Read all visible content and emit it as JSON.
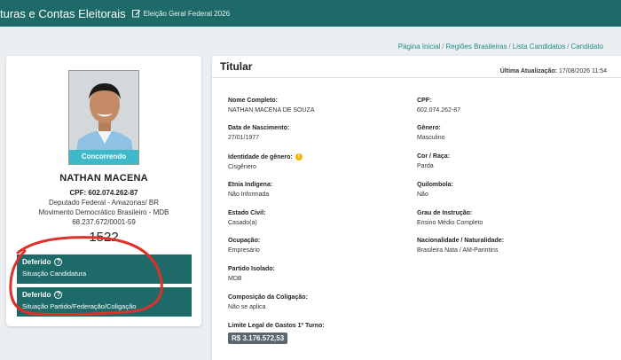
{
  "header": {
    "title": "turas e Contas Eleitorais",
    "election_label": "Eleição Geral Federal 2026"
  },
  "breadcrumb": [
    "Página Inicial",
    "Regiões Brasileiras",
    "Lista Candidatos",
    "Candidato"
  ],
  "candidate": {
    "status_tag": "Concorrendo",
    "name": "NATHAN MACENA",
    "cpf_line": "CPF: 602.074.262-87",
    "office": "Deputado Federal - Amazonas/ BR",
    "party": "Movimento Democrático Brasileiro - MDB",
    "cnpj": "68.237.672/0001-59",
    "number": "1522"
  },
  "status_boxes": [
    {
      "title": "Deferido",
      "subtitle": "Situação Candidatura"
    },
    {
      "title": "Deferido",
      "subtitle": "Situação Partido/Federação/Coligação"
    }
  ],
  "details": {
    "heading": "Titular",
    "updated_label": "Última Atualização:",
    "updated_value": "17/08/2026 11:54",
    "fields": {
      "full_name": {
        "label": "Nome Completo:",
        "value": "NATHAN MACENA DE SOUZA"
      },
      "cpf": {
        "label": "CPF:",
        "value": "602.074.262-87"
      },
      "birth": {
        "label": "Data de Nascimento:",
        "value": "27/01/1977"
      },
      "gender": {
        "label": "Gênero:",
        "value": "Masculino"
      },
      "gender_identity": {
        "label": "Identidade de gênero:",
        "value": "Cisgênero"
      },
      "race": {
        "label": "Cor / Raça:",
        "value": "Parda"
      },
      "ethnicity": {
        "label": "Etnia Indígena:",
        "value": "Não Informada"
      },
      "quilombola": {
        "label": "Quilombola:",
        "value": "Não"
      },
      "civil": {
        "label": "Estado Civil:",
        "value": "Casado(a)"
      },
      "education": {
        "label": "Grau de Instrução:",
        "value": "Ensino Médio Completo"
      },
      "occupation": {
        "label": "Ocupação:",
        "value": "Empresário"
      },
      "nationality": {
        "label": "Nacionalidade / Naturalidade:",
        "value": "Brasileira Nata / AM-Parintins"
      },
      "party_isolated": {
        "label": "Partido Isolado:",
        "value": "MDB"
      },
      "coalition": {
        "label": "Composição da Coligação:",
        "value": "Não se aplica"
      },
      "spending_limit": {
        "label": "Limite Legal de Gastos 1º Turno:",
        "value": "R$ 3.176.572,53"
      }
    }
  },
  "icons": {
    "edit": "edit-icon",
    "help": "question-circle-icon",
    "warning": "warning-icon"
  },
  "colors": {
    "topbar": "#1d6a68",
    "status_tag": "#3fb8c9",
    "accent_link": "#1e8a83",
    "annotation": "#e0302a"
  }
}
